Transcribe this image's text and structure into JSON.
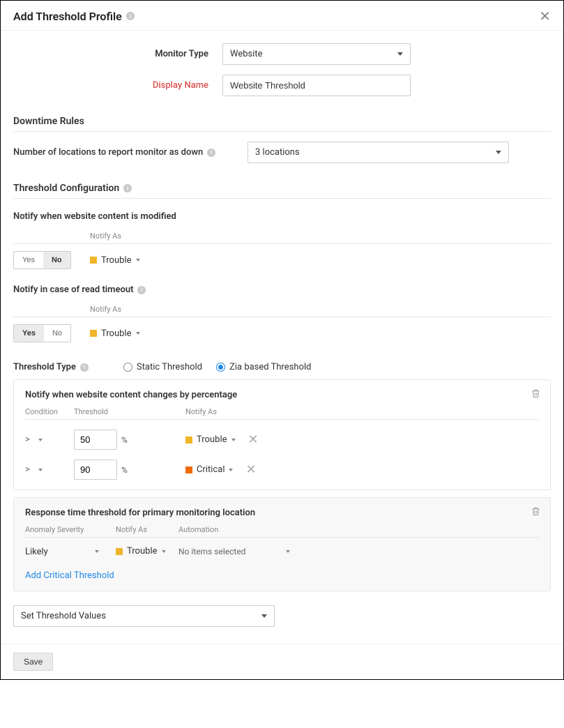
{
  "header": {
    "title": "Add Threshold Profile"
  },
  "form": {
    "monitor_type": {
      "label": "Monitor Type",
      "value": "Website"
    },
    "display_name": {
      "label": "Display Name",
      "value": "Website Threshold"
    }
  },
  "downtime": {
    "section": "Downtime Rules",
    "locations": {
      "label": "Number of locations to report monitor as down",
      "value": "3 locations"
    }
  },
  "threshold_cfg": {
    "section": "Threshold Configuration",
    "content_modified": {
      "label": "Notify when website content is modified",
      "notify_as_header": "Notify As",
      "yes": "Yes",
      "no": "No",
      "selected": "No",
      "notify_as": "Trouble"
    },
    "read_timeout": {
      "label": "Notify in case of read timeout",
      "notify_as_header": "Notify As",
      "yes": "Yes",
      "no": "No",
      "selected": "Yes",
      "notify_as": "Trouble"
    }
  },
  "threshold_type": {
    "label": "Threshold Type",
    "static": "Static Threshold",
    "zia": "Zia based Threshold",
    "selected": "zia"
  },
  "content_change_pct": {
    "title": "Notify when website content changes by percentage",
    "headers": {
      "condition": "Condition",
      "threshold": "Threshold",
      "notify_as": "Notify As"
    },
    "rows": [
      {
        "op": ">",
        "value": "50",
        "unit": "%",
        "notify_as": "Trouble",
        "severity_class": "trouble"
      },
      {
        "op": ">",
        "value": "90",
        "unit": "%",
        "notify_as": "Critical",
        "severity_class": "critical"
      }
    ]
  },
  "response_time": {
    "title": "Response time threshold for primary monitoring location",
    "headers": {
      "anomaly": "Anomaly Severity",
      "notify_as": "Notify As",
      "automation": "Automation"
    },
    "row": {
      "anomaly": "Likely",
      "notify_as": "Trouble",
      "automation": "No items selected"
    },
    "add_link": "Add Critical Threshold"
  },
  "set_values": {
    "label": "Set Threshold Values"
  },
  "footer": {
    "save": "Save"
  }
}
